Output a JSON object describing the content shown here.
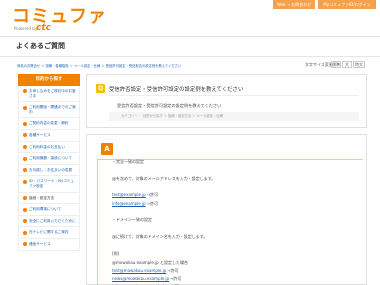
{
  "header": {
    "logo_text": "コミュファ",
    "logo_sub": "Powered by",
    "logo_brand": "ctc",
    "btn_web": "Web → お問合わせ",
    "btn_mypage": "MyコミュファID/ログイン"
  },
  "page_title": "よくあるご質問",
  "breadcrumb": "商品のお問合せ ＞ 設備・各種取扱 ＞ メール設定・仕様 ＞ 受信許可設定・受信拒否の設定例を教えてください",
  "font_size": {
    "label": "文字サイズ変更",
    "small": "標準",
    "medium": "大",
    "large": "特大"
  },
  "sidebar": {
    "heading": "目的から探す",
    "items": [
      {
        "label": "お申し込みをご検討中のお客さま"
      },
      {
        "label": "ご利用開始・開通までのご案内"
      },
      {
        "label": "ご契約内容の変更・解約"
      },
      {
        "label": "各種サービス"
      },
      {
        "label": "ご利用料金のお支払い"
      },
      {
        "label": "ご利用機器・接続について"
      },
      {
        "label": "お引越し・お住まいの変更"
      },
      {
        "label": "ID・パスワード・Myコミュファ設定"
      },
      {
        "label": "接続・設定方法"
      },
      {
        "label": "ご利用環境について"
      },
      {
        "label": "安全にご利用いただくために"
      },
      {
        "label": "光テレビに関するご案内"
      },
      {
        "label": "通信サービス"
      }
    ]
  },
  "question": {
    "badge": "Q",
    "title": "受信許否設定・受信許可設定の設定例を教えてください",
    "subtitle": "受信許否設定・受信許可設定の設定例を教えてください",
    "categories": "カテゴリー ： 目的から探す ＞ 接続・設定方法 ＞ メール設定・仕様"
  },
  "answer": {
    "badge": "A",
    "lines": [
      {
        "text": "・完全一致の設定",
        "link": false
      },
      {
        "text": "@を含めて、対象のメールアドレスを入力・設定します。",
        "link": false
      },
      {
        "text": "test@example.jp",
        "link": true,
        "suffix": "→許可"
      },
      {
        "text": "info@example.jp",
        "link": true,
        "suffix": "→許可"
      },
      {
        "text": "・ドメイン一致の設定",
        "link": false
      },
      {
        "text": "@に続けて、対象のドメイン名を入力・設定します。",
        "link": false
      },
      {
        "text": "[例]",
        "link": false
      },
      {
        "text": "@mowakau.example.jp と設定した場合",
        "link": false
      },
      {
        "text": "test@mowakau.example.jp",
        "link": true,
        "suffix": "→許可"
      },
      {
        "text": "news@mowakau.example.jp",
        "link": true,
        "suffix": "→許可"
      },
      {
        "text": "info@mowakau.example.jp",
        "link": true,
        "suffix": "→許可"
      }
    ]
  }
}
